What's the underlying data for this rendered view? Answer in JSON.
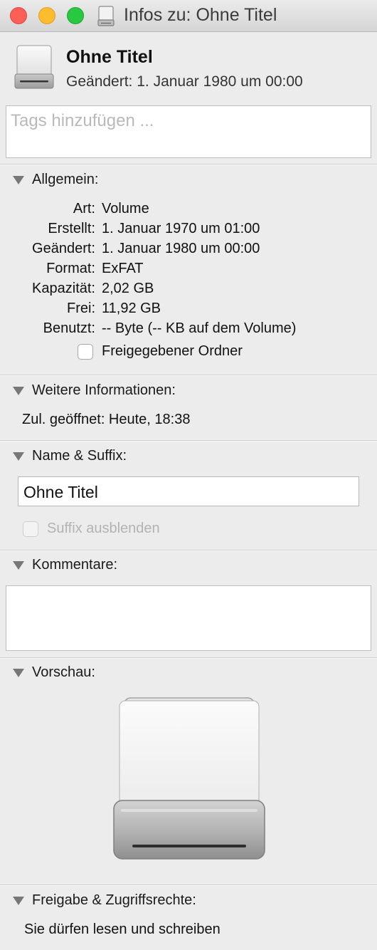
{
  "window": {
    "title": "Infos zu: Ohne Titel"
  },
  "header": {
    "name": "Ohne Titel",
    "modified": "Geändert: 1. Januar 1980 um 00:00",
    "icon": "drive-icon"
  },
  "tags": {
    "placeholder": "Tags hinzufügen ..."
  },
  "general": {
    "heading": "Allgemein:",
    "rows": [
      {
        "label": "Art:",
        "value": "Volume"
      },
      {
        "label": "Erstellt:",
        "value": "1. Januar 1970 um 01:00"
      },
      {
        "label": "Geändert:",
        "value": "1. Januar 1980 um 00:00"
      },
      {
        "label": "Format:",
        "value": "ExFAT"
      },
      {
        "label": "Kapazität:",
        "value": "2,02 GB"
      },
      {
        "label": "Frei:",
        "value": "11,92 GB"
      },
      {
        "label": "Benutzt:",
        "value": "-- Byte (-- KB auf dem Volume)"
      }
    ],
    "shared_folder": {
      "label": "Freigegebener Ordner",
      "checked": false
    }
  },
  "more_info": {
    "heading": "Weitere Informationen:",
    "last_opened": "Zul. geöffnet: Heute, 18:38"
  },
  "name_suffix": {
    "heading": "Name & Suffix:",
    "name_value": "Ohne Titel",
    "hide_suffix": {
      "label": "Suffix ausblenden",
      "checked": false,
      "enabled": false
    }
  },
  "comments": {
    "heading": "Kommentare:",
    "value": ""
  },
  "preview": {
    "heading": "Vorschau:",
    "icon": "drive-icon"
  },
  "sharing": {
    "heading": "Freigabe & Zugriffsrechte:",
    "text": "Sie dürfen lesen und schreiben"
  },
  "colors": {
    "close": "#fc5f57",
    "minimize": "#fdbc2e",
    "zoom": "#28c840",
    "background": "#ececec"
  }
}
